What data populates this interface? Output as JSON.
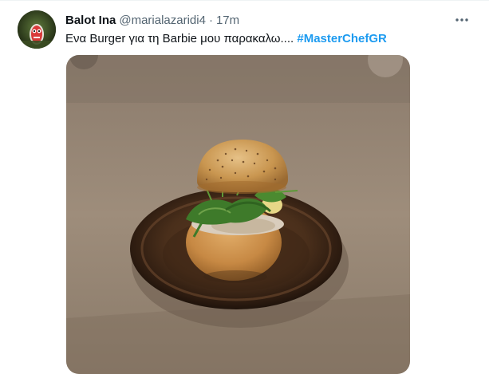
{
  "tweet": {
    "author": {
      "display_name": "Balot Ina",
      "handle": "@marialazaridi4",
      "separator": "·",
      "time": "17m"
    },
    "text": "Ενα Burger για τη Barbie μου παρακαλω....",
    "hashtag": "#MasterChefGR",
    "more_icon": "more-horizontal-icon",
    "media": {
      "kind": "photo",
      "subject": "small burger on a dark ceramic plate"
    }
  },
  "colors": {
    "text_primary": "#0f1419",
    "text_secondary": "#536471",
    "link": "#1d9bf0",
    "background": "#ffffff"
  }
}
